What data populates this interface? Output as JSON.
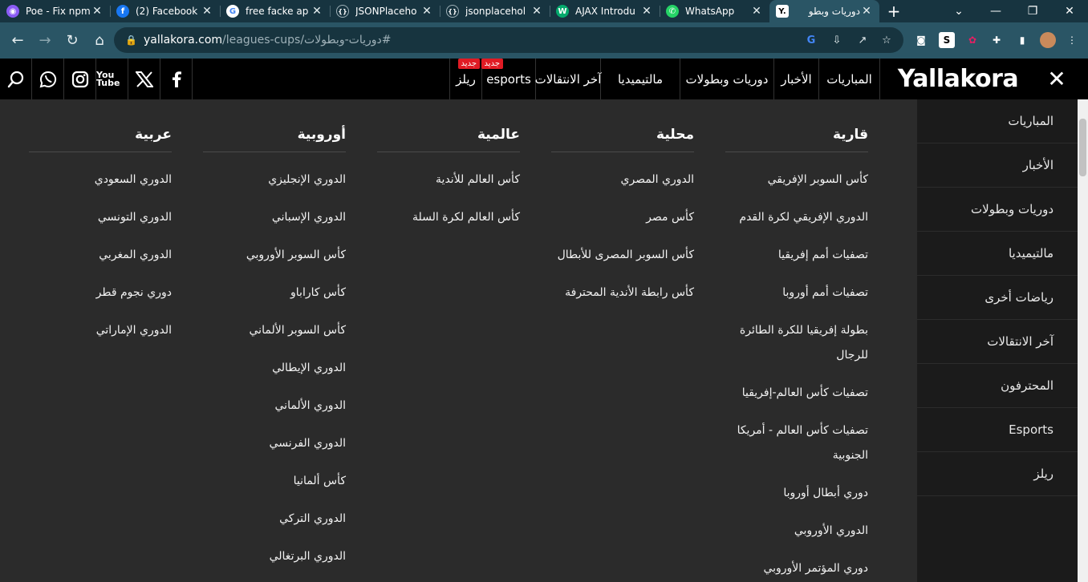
{
  "browser": {
    "tabs": [
      {
        "title": "Poe - Fix npm",
        "icon": "poe-icon",
        "color": "#8b5cf6"
      },
      {
        "title": "(2) Facebook",
        "icon": "facebook-icon",
        "color": "#1877f2"
      },
      {
        "title": "free facke ap",
        "icon": "google-icon",
        "color": "#ffffff"
      },
      {
        "title": "JSONPlaceho",
        "icon": "jsonplaceholder-icon",
        "color": "#173440"
      },
      {
        "title": "jsonplacehol",
        "icon": "jsonplaceholder-icon",
        "color": "#173440"
      },
      {
        "title": "AJAX Introdu",
        "icon": "w3schools-icon",
        "color": "#04aa6d"
      },
      {
        "title": "WhatsApp",
        "icon": "whatsapp-icon",
        "color": "#25d366"
      },
      {
        "title": "دوريات وبطو",
        "icon": "yallakora-icon",
        "color": "#000000",
        "active": true
      }
    ],
    "url": "yallakora.com/leagues-cups/دوريات-وبطولات#",
    "url_host": "yallakora.com",
    "url_path": "/leagues-cups/دوريات-وبطولات#"
  },
  "site": {
    "logo": "Yallakora",
    "nav": [
      {
        "label": "المباريات"
      },
      {
        "label": "الأخبار"
      },
      {
        "label": "دوريات وبطولات"
      },
      {
        "label": "مالتيميديا"
      },
      {
        "label": "آخر الانتقالات"
      },
      {
        "label": "esports",
        "badge": "جديد"
      },
      {
        "label": "ريلز",
        "badge": "جديد"
      }
    ],
    "social": [
      "facebook-icon",
      "x-icon",
      "youtube-icon",
      "instagram-icon",
      "whatsapp-icon",
      "search-icon"
    ],
    "youtube_text": "You Tube"
  },
  "mega_menu": {
    "columns": [
      {
        "heading": "قارية",
        "links": [
          "كأس السوبر الإفريقي",
          "الدوري الإفريقي لكرة القدم",
          "تصفيات أمم إفريقيا",
          "تصفيات أمم أوروبا",
          "بطولة إفريقيا للكرة الطائرة للرجال",
          "تصفيات كأس العالم-إفريقيا",
          "تصفيات كأس العالم - أمريكا الجنوبية",
          "دوري أبطال أوروبا",
          "الدوري الأوروبي",
          "دوري المؤتمر الأوروبي"
        ]
      },
      {
        "heading": "محلية",
        "links": [
          "الدوري المصري",
          "كأس مصر",
          "كأس السوبر المصرى للأبطال",
          "كأس رابطة الأندية المحترفة"
        ]
      },
      {
        "heading": "عالمية",
        "links": [
          "كأس العالم للأندية",
          "كأس العالم لكرة السلة"
        ]
      },
      {
        "heading": "أوروبية",
        "links": [
          "الدوري الإنجليزي",
          "الدوري الإسباني",
          "كأس السوبر الأوروبي",
          "كأس كاراباو",
          "كأس السوبر الألماني",
          "الدوري الإيطالي",
          "الدوري الألماني",
          "الدوري الفرنسي",
          "كأس ألمانيا",
          "الدوري التركي",
          "الدوري البرتغالي"
        ]
      },
      {
        "heading": "عربية",
        "links": [
          "الدوري السعودي",
          "الدوري التونسي",
          "الدوري المغربي",
          "دوري نجوم قطر",
          "الدوري الإماراتي"
        ]
      }
    ]
  },
  "sidebar": {
    "items": [
      "المباريات",
      "الأخبار",
      "دوريات وبطولات",
      "مالتيميديا",
      "رياضات أخرى",
      "آخر الانتقالات",
      "المحترفون",
      "Esports",
      "ريلز"
    ]
  }
}
